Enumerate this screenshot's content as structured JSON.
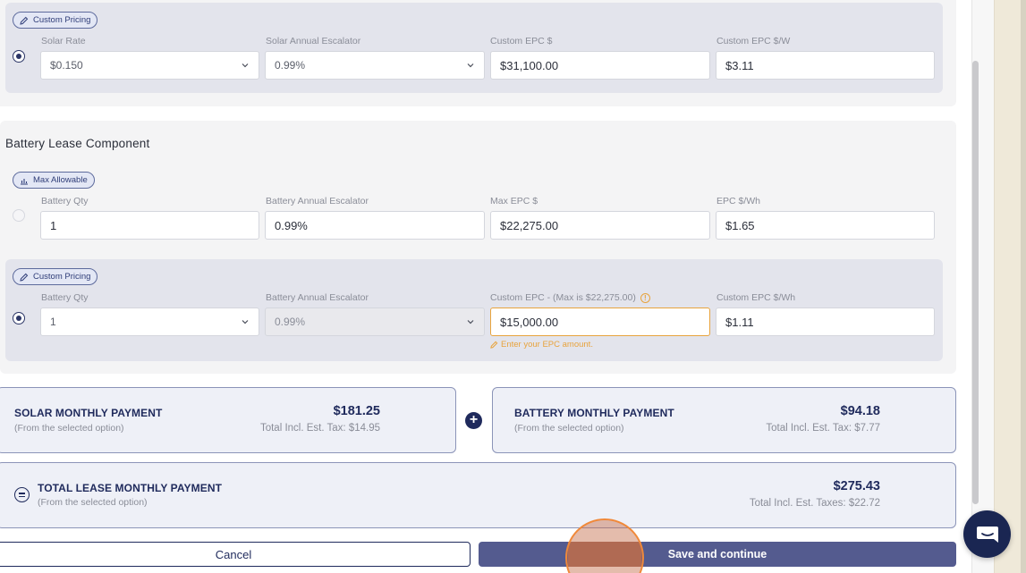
{
  "solar_custom": {
    "tag": "Custom Pricing",
    "labels": {
      "rate": "Solar Rate",
      "escalator": "Solar Annual Escalator",
      "epc": "Custom EPC $",
      "epc_w": "Custom EPC $/W"
    },
    "values": {
      "rate": "$0.150",
      "escalator": "0.99%",
      "epc": "$31,100.00",
      "epc_w": "$3.11"
    }
  },
  "battery": {
    "section_title": "Battery Lease Component",
    "max_allowable": {
      "tag": "Max Allowable",
      "labels": {
        "qty": "Battery Qty",
        "escalator": "Battery Annual Escalator",
        "epc": "Max EPC $",
        "epc_wh": "EPC $/Wh"
      },
      "values": {
        "qty": "1",
        "escalator": "0.99%",
        "epc": "$22,275.00",
        "epc_wh": "$1.65"
      }
    },
    "custom": {
      "tag": "Custom Pricing",
      "labels": {
        "qty": "Battery Qty",
        "escalator": "Battery Annual Escalator",
        "epc": "Custom EPC - (Max is $22,275.00)",
        "epc_wh": "Custom EPC $/Wh"
      },
      "values": {
        "qty": "1",
        "escalator": "0.99%",
        "epc": "$15,000.00",
        "epc_wh": "$1.11"
      },
      "hint": "Enter your EPC amount."
    }
  },
  "payments": {
    "solar": {
      "title": "SOLAR MONTHLY PAYMENT",
      "subtitle": "(From the selected option)",
      "amount": "$181.25",
      "tax": "Total Incl. Est. Tax: $14.95"
    },
    "battery": {
      "title": "BATTERY MONTHLY PAYMENT",
      "subtitle": "(From the selected option)",
      "amount": "$94.18",
      "tax": "Total Incl. Est. Tax: $7.77"
    },
    "total": {
      "title": "TOTAL LEASE MONTHLY PAYMENT",
      "subtitle": "(From the selected option)",
      "amount": "$275.43",
      "tax": "Total Incl. Est. Taxes: $22.72"
    }
  },
  "actions": {
    "cancel": "Cancel",
    "save": "Save and continue"
  },
  "colors": {
    "brand_navy": "#1f2a5c",
    "save_button": "#545b8f",
    "warning": "#e8a33d"
  },
  "icons": [
    "pencil-icon",
    "chart-icon",
    "chevron-down-icon",
    "info-icon",
    "plus-icon",
    "equals-icon",
    "chat-icon"
  ]
}
